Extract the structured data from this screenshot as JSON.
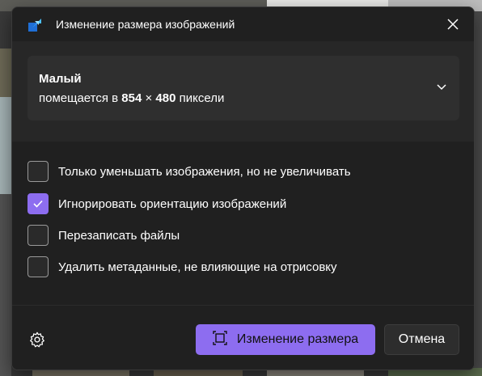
{
  "dialog": {
    "title": "Изменение размера изображений",
    "app_icon": "image-resizer-app-icon",
    "close_icon": "close-icon"
  },
  "size_select": {
    "name": "Малый",
    "desc_prefix": "помещается в",
    "width": "854",
    "times": "×",
    "height": "480",
    "desc_suffix": "пиксели",
    "chevron_icon": "chevron-down-icon"
  },
  "options": [
    {
      "label": "Только уменьшать изображения, но не увеличивать",
      "checked": false
    },
    {
      "label": "Игнорировать ориентацию изображений",
      "checked": true
    },
    {
      "label": "Перезаписать файлы",
      "checked": false
    },
    {
      "label": "Удалить метаданные, не влияющие на отрисовку",
      "checked": false
    }
  ],
  "footer": {
    "settings_icon": "gear-icon",
    "resize_icon": "resize-icon",
    "resize_label": "Изменение размера",
    "cancel_label": "Отмена"
  },
  "colors": {
    "accent": "#8d6df0",
    "dialog_bg": "#202020",
    "panel_bg": "#272727",
    "select_bg": "#2f2f2f"
  }
}
